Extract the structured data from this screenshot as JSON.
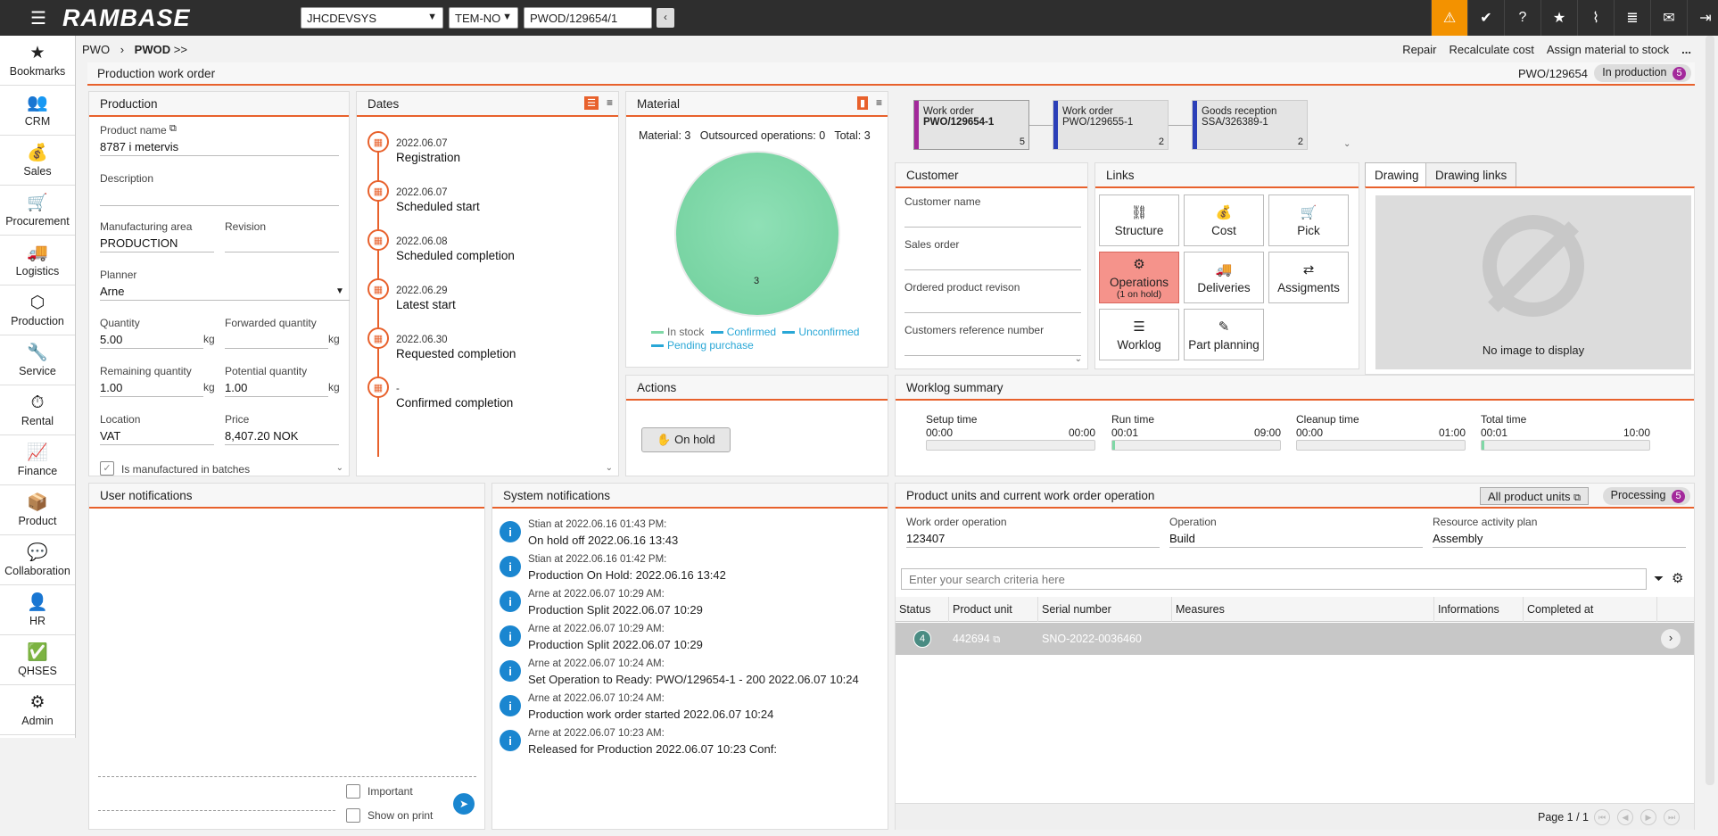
{
  "topbar": {
    "logo": "RAMBASE",
    "company": "JHCDEVSYS",
    "region": "TEM-NO",
    "search_value": "PWOD/129654/1"
  },
  "sidebar": {
    "items": [
      {
        "label": "Bookmarks",
        "icon": "star-icon"
      },
      {
        "label": "CRM",
        "icon": "people-icon"
      },
      {
        "label": "Sales",
        "icon": "money-bag-icon"
      },
      {
        "label": "Procurement",
        "icon": "cart-icon"
      },
      {
        "label": "Logistics",
        "icon": "truck-icon"
      },
      {
        "label": "Production",
        "icon": "boxes-icon"
      },
      {
        "label": "Service",
        "icon": "wrench-icon"
      },
      {
        "label": "Rental",
        "icon": "rental-icon"
      },
      {
        "label": "Finance",
        "icon": "chart-line-icon"
      },
      {
        "label": "Product",
        "icon": "box-icon"
      },
      {
        "label": "Collaboration",
        "icon": "chat-icon"
      },
      {
        "label": "HR",
        "icon": "person-icon"
      },
      {
        "label": "QHSES",
        "icon": "shield-check-icon"
      },
      {
        "label": "Admin",
        "icon": "gear-icon"
      }
    ]
  },
  "breadcrumb": {
    "root": "PWO",
    "current": "PWOD",
    "suffix": ">>"
  },
  "header_actions": {
    "repair": "Repair",
    "recalc": "Recalculate cost",
    "assign": "Assign material to stock",
    "more": "..."
  },
  "page": {
    "title": "Production work order",
    "id": "PWO/129654",
    "status": "In production",
    "status_count": "5"
  },
  "production": {
    "title": "Production",
    "product_name_label": "Product name",
    "product_name": "8787 i metervis",
    "description_label": "Description",
    "description": "",
    "manufacturing_area_label": "Manufacturing area",
    "manufacturing_area": "PRODUCTION",
    "revision_label": "Revision",
    "revision": "",
    "planner_label": "Planner",
    "planner": "Arne",
    "quantity_label": "Quantity",
    "quantity": "5.00",
    "quantity_unit": "kg",
    "forwarded_label": "Forwarded quantity",
    "forwarded": "",
    "forwarded_unit": "kg",
    "remaining_label": "Remaining quantity",
    "remaining": "1.00",
    "remaining_unit": "kg",
    "potential_label": "Potential quantity",
    "potential": "1.00",
    "potential_unit": "kg",
    "location_label": "Location",
    "location": "VAT",
    "price_label": "Price",
    "price": "8,407.20 NOK",
    "batches_label": "Is manufactured in batches"
  },
  "dates": {
    "title": "Dates",
    "items": [
      {
        "date": "2022.06.07",
        "name": "Registration"
      },
      {
        "date": "2022.06.07",
        "name": "Scheduled start"
      },
      {
        "date": "2022.06.08",
        "name": "Scheduled completion"
      },
      {
        "date": "2022.06.29",
        "name": "Latest start"
      },
      {
        "date": "2022.06.30",
        "name": "Requested completion"
      },
      {
        "date": "-",
        "name": "Confirmed completion"
      }
    ]
  },
  "material": {
    "title": "Material",
    "summary_material": "Material: 3",
    "summary_outsourced": "Outsourced operations: 0",
    "summary_total": "Total: 3",
    "pie_label": "3",
    "legend": [
      {
        "label": "In stock",
        "color": "#7fd8a6"
      },
      {
        "label": "Confirmed",
        "color": "#29a7d6"
      },
      {
        "label": "Unconfirmed",
        "color": "#29a7d6"
      },
      {
        "label": "Pending purchase",
        "color": "#29a7d6"
      }
    ]
  },
  "workorders": [
    {
      "type": "Work order",
      "id": "PWO/129654-1",
      "count": "5",
      "color": "#a3299b"
    },
    {
      "type": "Work order",
      "id": "PWO/129655-1",
      "count": "2",
      "color": "#2b3fb8"
    },
    {
      "type": "Goods reception",
      "id": "SSA/326389-1",
      "count": "2",
      "color": "#2b3fb8"
    }
  ],
  "customer": {
    "title": "Customer",
    "name_label": "Customer name",
    "sales_order_label": "Sales order",
    "ordered_revision_label": "Ordered product revison",
    "reference_label": "Customers reference number"
  },
  "links": {
    "title": "Links",
    "items": [
      {
        "label": "Structure",
        "icon": "structure-icon"
      },
      {
        "label": "Cost",
        "icon": "money-bag-icon"
      },
      {
        "label": "Pick",
        "icon": "cart-icon"
      },
      {
        "label": "Operations",
        "sub": "(1 on hold)",
        "icon": "gears-icon"
      },
      {
        "label": "Deliveries",
        "icon": "truck-icon"
      },
      {
        "label": "Assigments",
        "icon": "assign-icon"
      },
      {
        "label": "Worklog",
        "icon": "list-icon"
      },
      {
        "label": "Part planning",
        "icon": "edit-icon"
      }
    ]
  },
  "drawing": {
    "tab1": "Drawing",
    "tab2": "Drawing links",
    "no_image": "No image to display"
  },
  "actions": {
    "title": "Actions",
    "on_hold": "On hold"
  },
  "worklog": {
    "title": "Worklog summary",
    "items": [
      {
        "label": "Setup time",
        "start": "00:00",
        "end": "00:00",
        "fill": 0
      },
      {
        "label": "Run time",
        "start": "00:01",
        "end": "09:00",
        "fill": 0.01
      },
      {
        "label": "Cleanup time",
        "start": "00:00",
        "end": "01:00",
        "fill": 0
      },
      {
        "label": "Total time",
        "start": "00:01",
        "end": "10:00",
        "fill": 0.01
      }
    ]
  },
  "user_notifications": {
    "title": "User notifications",
    "important": "Important",
    "show_on_print": "Show on print"
  },
  "system_notifications": {
    "title": "System notifications",
    "items": [
      {
        "meta": "Stian at 2022.06.16 01:43 PM:",
        "msg": "On hold off 2022.06.16 13:43"
      },
      {
        "meta": "Stian at 2022.06.16 01:42 PM:",
        "msg": "Production On Hold: 2022.06.16 13:42"
      },
      {
        "meta": "Arne at 2022.06.07 10:29 AM:",
        "msg": "Production Split 2022.06.07 10:29"
      },
      {
        "meta": "Arne at 2022.06.07 10:29 AM:",
        "msg": "Production Split 2022.06.07 10:29"
      },
      {
        "meta": "Arne at 2022.06.07 10:24 AM:",
        "msg": "Set Operation to Ready: PWO/129654-1 - 200 2022.06.07 10:24"
      },
      {
        "meta": "Arne at 2022.06.07 10:24 AM:",
        "msg": "Production work order started 2022.06.07 10:24"
      },
      {
        "meta": "Arne at 2022.06.07 10:23 AM:",
        "msg": "Released for Production 2022.06.07 10:23 Conf:"
      }
    ]
  },
  "product_units": {
    "title": "Product units and current work order operation",
    "all_units": "All product units",
    "processing": "Processing",
    "processing_count": "5",
    "wo_op_label": "Work order operation",
    "wo_op": "123407",
    "operation_label": "Operation",
    "operation": "Build",
    "rap_label": "Resource activity plan",
    "rap": "Assembly",
    "search_placeholder": "Enter your search criteria here",
    "columns": [
      "Status",
      "Product unit",
      "Serial number",
      "Measures",
      "Informations",
      "Completed at"
    ],
    "row": {
      "status": "4",
      "unit": "442694",
      "serial": "SNO-2022-0036460"
    },
    "page": "Page 1 / 1"
  }
}
